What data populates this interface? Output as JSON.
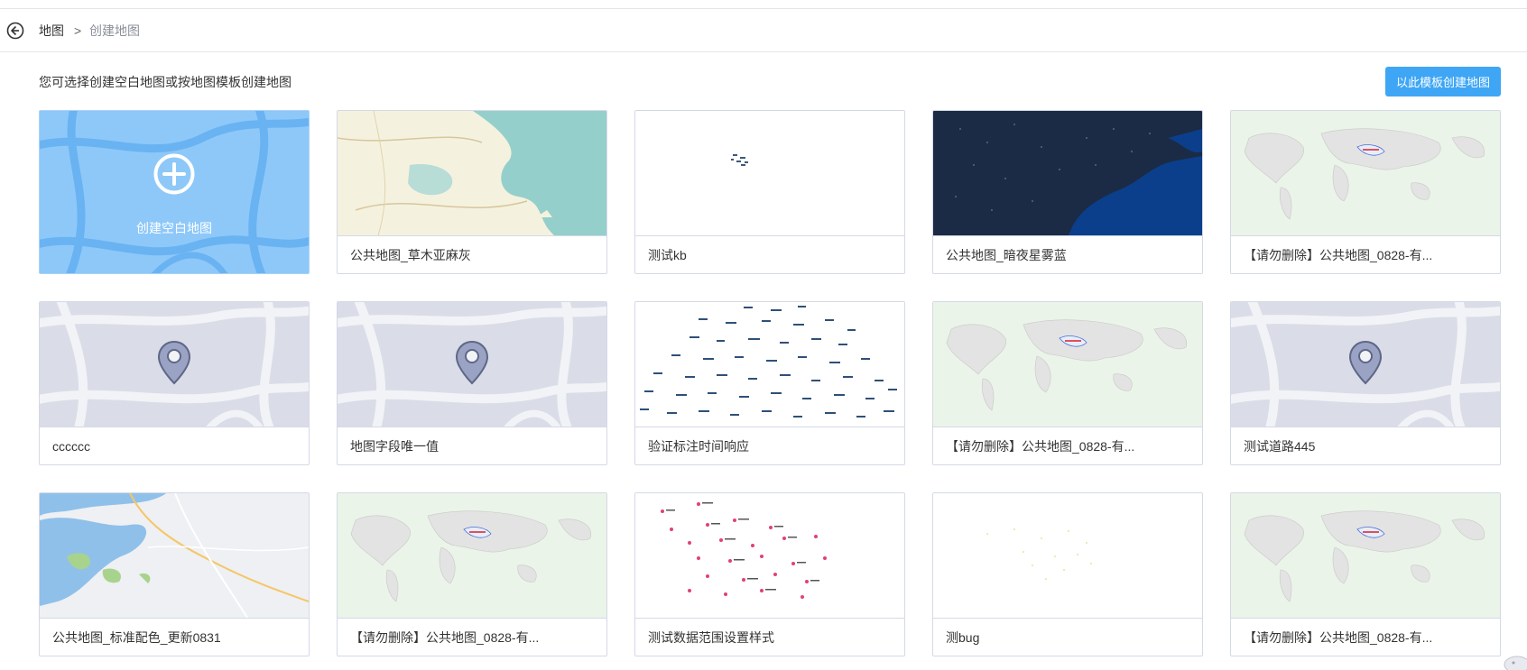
{
  "breadcrumb": {
    "root": "地图",
    "separator": ">",
    "current": "创建地图"
  },
  "intro_text": "您可选择创建空白地图或按地图模板创建地图",
  "primary_button_label": "以此模板创建地图",
  "blank_card_label": "创建空白地图",
  "cards": [
    {
      "label": "公共地图_草木亚麻灰",
      "thumb": "map-light-coast"
    },
    {
      "label": "测试kb",
      "thumb": "blank-dots"
    },
    {
      "label": "公共地图_暗夜星雾蓝",
      "thumb": "map-dark-blue"
    },
    {
      "label": "【请勿删除】公共地图_0828-有...",
      "thumb": "world-map"
    },
    {
      "label": "cccccc",
      "thumb": "placeholder-pin"
    },
    {
      "label": "地图字段唯一值",
      "thumb": "placeholder-pin"
    },
    {
      "label": "验证标注时间响应",
      "thumb": "scatter-labels-blue"
    },
    {
      "label": "【请勿删除】公共地图_0828-有...",
      "thumb": "world-map"
    },
    {
      "label": "测试道路445",
      "thumb": "placeholder-pin"
    },
    {
      "label": "公共地图_标准配色_更新0831",
      "thumb": "map-standard"
    },
    {
      "label": "【请勿删除】公共地图_0828-有...",
      "thumb": "world-map"
    },
    {
      "label": "测试数据范围设置样式",
      "thumb": "scatter-labels-red"
    },
    {
      "label": "测bug",
      "thumb": "blank-faint-dots"
    },
    {
      "label": "【请勿删除】公共地图_0828-有...",
      "thumb": "world-map"
    }
  ],
  "colors": {
    "accent": "#3ea6f5",
    "blank_card": "#8ec8f9",
    "border": "#d4d9e6",
    "muted_text": "#8a8f99"
  },
  "icons": {
    "back": "circle-arrow-left-icon",
    "add": "plus-circle-icon",
    "pin": "map-pin-icon"
  }
}
